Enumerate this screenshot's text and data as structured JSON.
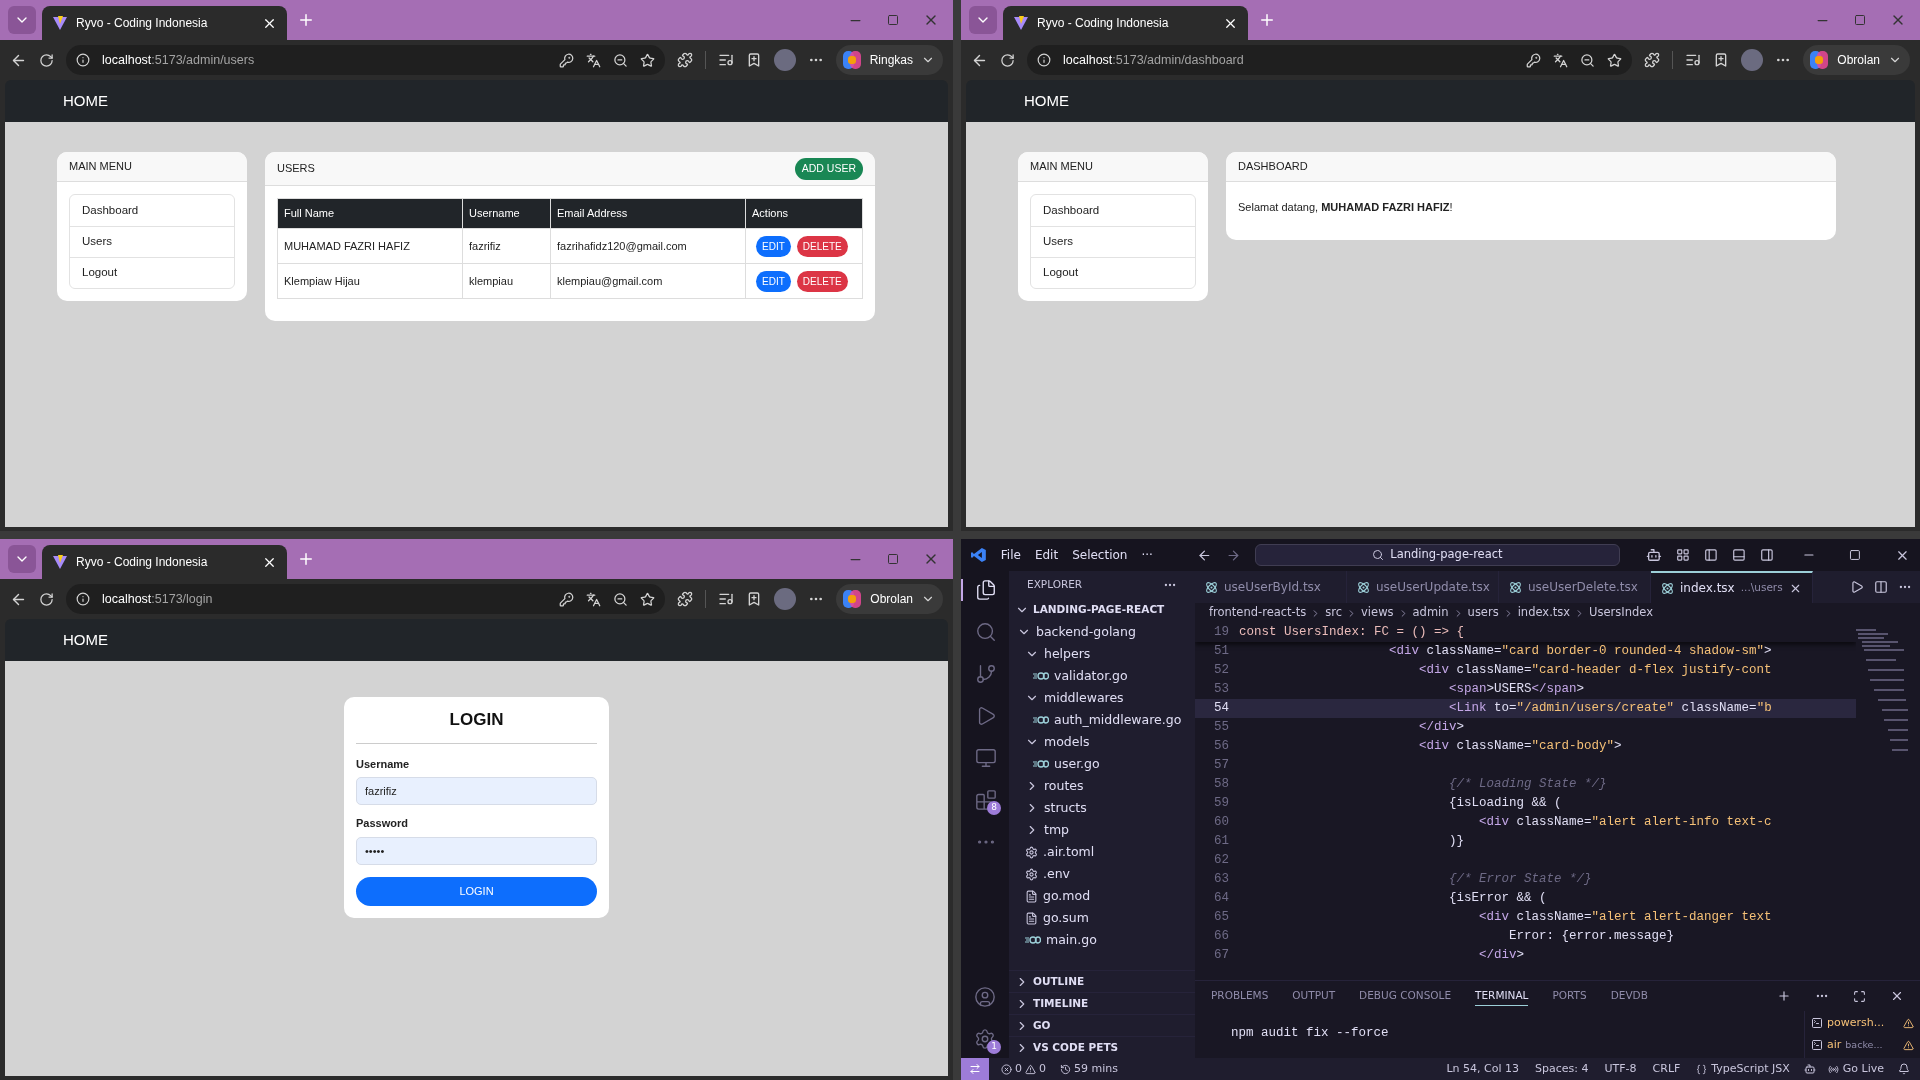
{
  "browsers": [
    {
      "tab_title": "Ryvo - Coding Indonesia",
      "url_host": "localhost",
      "url_path": ":5173/admin/users",
      "assistant_label": "Ringkas",
      "navbar_brand": "HOME",
      "page": {
        "kind": "users",
        "menu": {
          "title": "MAIN MENU",
          "items": [
            "Dashboard",
            "Users",
            "Logout"
          ]
        },
        "card": {
          "title": "USERS",
          "button": "ADD USER",
          "columns": [
            "Full Name",
            "Username",
            "Email Address",
            "Actions"
          ],
          "rows": [
            {
              "cells": [
                "MUHAMAD FAZRI HAFIZ",
                "fazrifiz",
                "fazrihafidz120@gmail.com"
              ],
              "edit": "EDIT",
              "delete": "DELETE"
            },
            {
              "cells": [
                "Klempiaw Hijau",
                "klempiau",
                "klempiau@gmail.com"
              ],
              "edit": "EDIT",
              "delete": "DELETE"
            }
          ]
        }
      }
    },
    {
      "tab_title": "Ryvo - Coding Indonesia",
      "url_host": "localhost",
      "url_path": ":5173/admin/dashboard",
      "assistant_label": "Obrolan",
      "navbar_brand": "HOME",
      "page": {
        "kind": "dashboard",
        "menu": {
          "title": "MAIN MENU",
          "items": [
            "Dashboard",
            "Users",
            "Logout"
          ]
        },
        "card": {
          "title": "DASHBOARD",
          "message": "Selamat datang, **MUHAMAD FAZRI HAFIZ**!"
        }
      }
    },
    {
      "tab_title": "Ryvo - Coding Indonesia",
      "url_host": "localhost",
      "url_path": ":5173/login",
      "assistant_label": "Obrolan",
      "navbar_brand": "HOME",
      "page": {
        "kind": "login",
        "title": "LOGIN",
        "fields": [
          {
            "label": "Username",
            "value": "fazrifiz"
          },
          {
            "label": "Password",
            "value": "•••••"
          }
        ],
        "button": "LOGIN"
      }
    }
  ],
  "editor": {
    "menu": [
      "File",
      "Edit",
      "Selection",
      "···"
    ],
    "search": "Landing-page-react",
    "activity": [
      {
        "kind": "files",
        "selected": true
      },
      {
        "kind": "search",
        "selected": false
      },
      {
        "kind": "git",
        "selected": false
      },
      {
        "kind": "debug",
        "selected": false
      },
      {
        "kind": "remote",
        "selected": false
      },
      {
        "kind": "extensions",
        "selected": false,
        "badge": "8"
      },
      {
        "kind": "more",
        "selected": false
      }
    ],
    "activity_bottom": [
      {
        "kind": "account"
      },
      {
        "kind": "settings",
        "badge": "1"
      }
    ],
    "explorer": {
      "title": "EXPLORER",
      "root": "LANDING-PAGE-REACT",
      "tree": [
        {
          "label": "backend-golang",
          "kind": "folder",
          "expanded": true,
          "children": [
            {
              "label": "helpers",
              "kind": "folder",
              "expanded": true,
              "children": [
                {
                  "label": "validator.go",
                  "kind": "go"
                }
              ]
            },
            {
              "label": "middlewares",
              "kind": "folder",
              "expanded": true,
              "children": [
                {
                  "label": "auth_middleware.go",
                  "kind": "go"
                }
              ]
            },
            {
              "label": "models",
              "kind": "folder",
              "expanded": true,
              "children": [
                {
                  "label": "user.go",
                  "kind": "go"
                }
              ]
            },
            {
              "label": "routes",
              "kind": "folder",
              "expanded": false
            },
            {
              "label": "structs",
              "kind": "folder",
              "expanded": false
            },
            {
              "label": "tmp",
              "kind": "folder",
              "expanded": false
            },
            {
              "label": ".air.toml",
              "kind": "config"
            },
            {
              "label": ".env",
              "kind": "config"
            },
            {
              "label": "go.mod",
              "kind": "text"
            },
            {
              "label": "go.sum",
              "kind": "text"
            },
            {
              "label": "main.go",
              "kind": "go"
            }
          ]
        }
      ],
      "sections": [
        {
          "label": "OUTLINE",
          "expanded": false
        },
        {
          "label": "TIMELINE",
          "expanded": false
        },
        {
          "label": "GO",
          "expanded": false
        },
        {
          "label": "VS CODE PETS",
          "expanded": false
        }
      ]
    },
    "tabs": [
      {
        "label": "useUserById.tsx",
        "selected": false
      },
      {
        "label": "useUserUpdate.tsx",
        "selected": false
      },
      {
        "label": "useUserDelete.tsx",
        "selected": false
      },
      {
        "label": "index.tsx",
        "hint": "...\\users",
        "selected": true
      }
    ],
    "breadcrumb": [
      "frontend-react-ts",
      "src",
      "views",
      "admin",
      "users",
      "index.tsx",
      "UsersIndex"
    ],
    "sticky": {
      "n": "19",
      "text": "const UsersIndex: FC = () => {"
    },
    "lines": [
      {
        "n": "51",
        "text": "                    <div className=\"card border-0 rounded-4 shadow-sm\">",
        "current": false
      },
      {
        "n": "52",
        "text": "                        <div className=\"card-header d-flex justify-cont",
        "current": false
      },
      {
        "n": "53",
        "text": "                            <span>USERS</span>",
        "current": false
      },
      {
        "n": "54",
        "text": "                            <Link to=\"/admin/users/create\" className=\"b",
        "current": true
      },
      {
        "n": "55",
        "text": "                        </div>",
        "current": false
      },
      {
        "n": "56",
        "text": "                        <div className=\"card-body\">",
        "current": false
      },
      {
        "n": "57",
        "current": false
      },
      {
        "n": "58",
        "text": "                            {/* Loading State */}",
        "current": false
      },
      {
        "n": "59",
        "text": "                            {isLoading && (",
        "current": false
      },
      {
        "n": "60",
        "text": "                                <div className=\"alert alert-info text-c",
        "current": false
      },
      {
        "n": "61",
        "text": "                            )}",
        "current": false
      },
      {
        "n": "62",
        "current": false
      },
      {
        "n": "63",
        "text": "                            {/* Error State */}",
        "current": false
      },
      {
        "n": "64",
        "text": "                            {isError && (",
        "current": false
      },
      {
        "n": "65",
        "text": "                                <div className=\"alert alert-danger text",
        "current": false
      },
      {
        "n": "66",
        "text": "                                    Error: {error.message}",
        "current": false
      },
      {
        "n": "67",
        "text": "                                </div>",
        "current": false
      }
    ],
    "panel_tabs": [
      {
        "label": "PROBLEMS",
        "selected": false
      },
      {
        "label": "OUTPUT",
        "selected": false
      },
      {
        "label": "DEBUG CONSOLE",
        "selected": false
      },
      {
        "label": "TERMINAL",
        "selected": true
      },
      {
        "label": "PORTS",
        "selected": false
      },
      {
        "label": "DEVDB",
        "selected": false
      }
    ],
    "terminal_text": "npm audit fix --force",
    "terminals": [
      {
        "name": "powersh..."
      },
      {
        "name": "air",
        "detail": "backe..."
      }
    ],
    "status": {
      "errors": "0",
      "warnings": "0",
      "time": "59 mins",
      "items": [
        "Ln 54, Col 13",
        "Spaces: 4",
        "UTF-8",
        "CRLF"
      ],
      "language": "TypeScript JSX",
      "live": "Go Live"
    }
  }
}
